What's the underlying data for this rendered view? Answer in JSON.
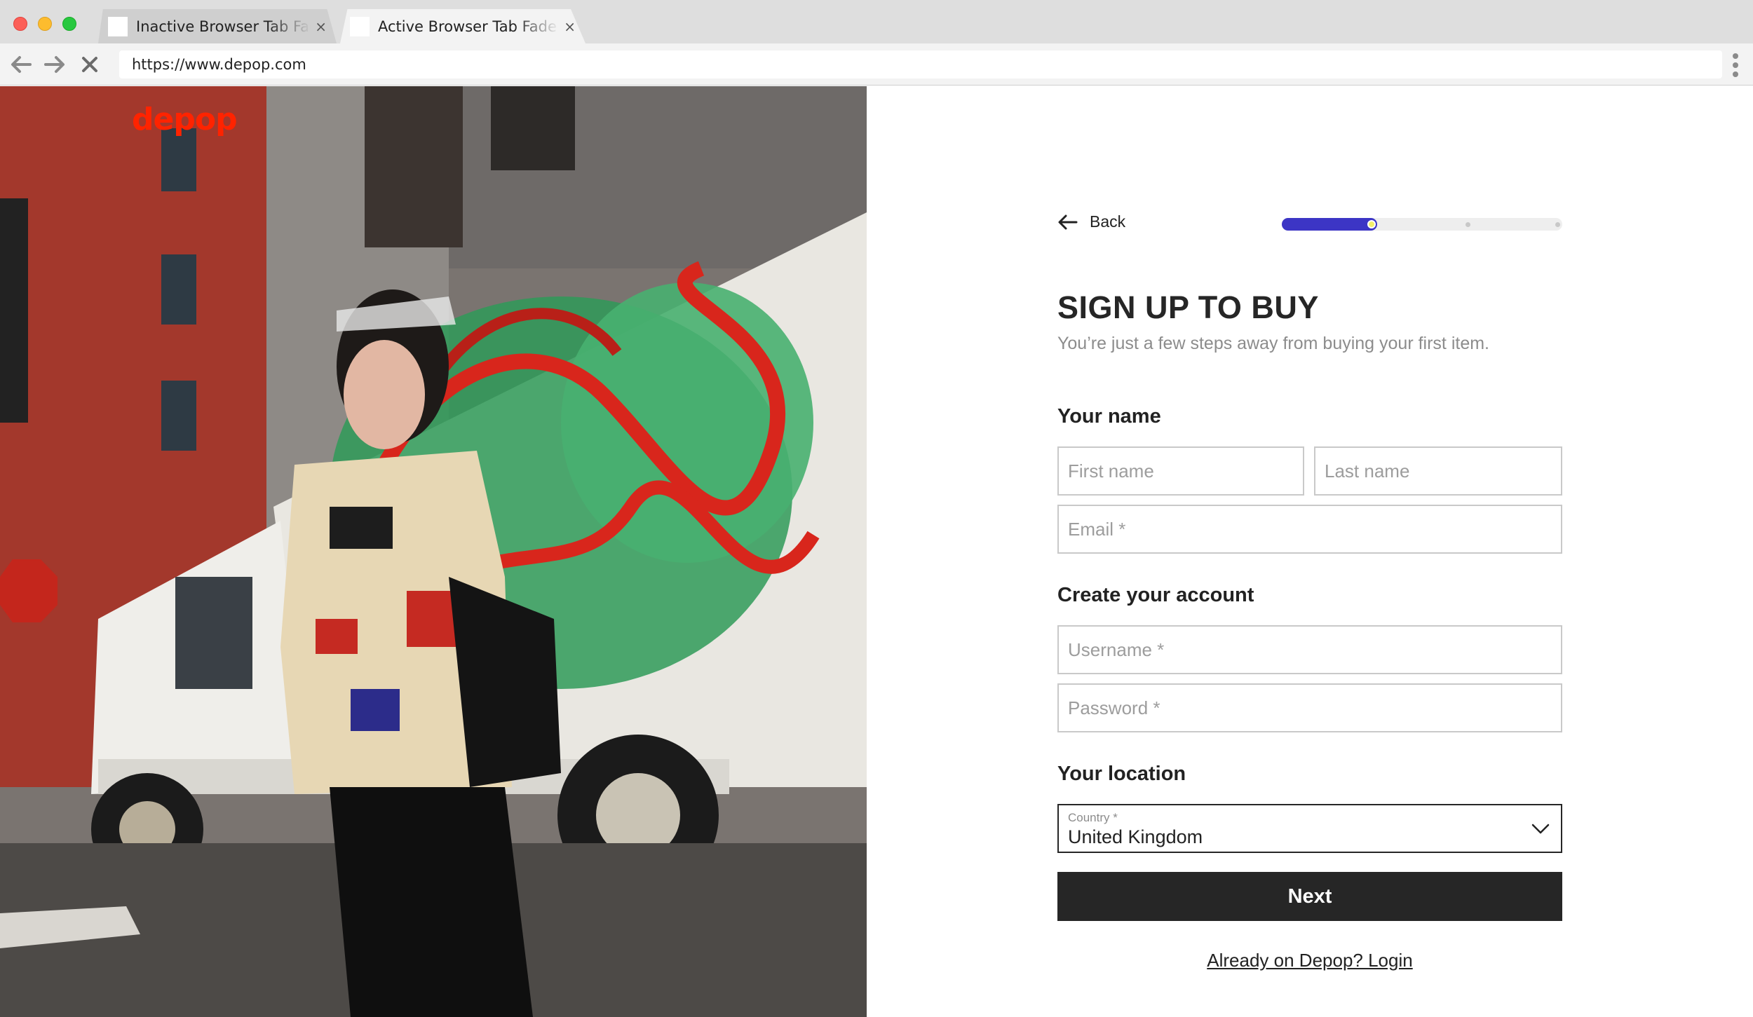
{
  "browser": {
    "tabs": [
      {
        "title": "Inactive Browser Tab Fad",
        "active": false
      },
      {
        "title": "Active Browser Tab Fade",
        "active": true
      }
    ],
    "url": "https://www.depop.com",
    "close_glyph": "×"
  },
  "hero": {
    "logo": "depop",
    "brand_color": "#ff2300"
  },
  "form": {
    "back_label": "Back",
    "progress": {
      "step": 1,
      "total_steps": 3,
      "fraction": 0.34,
      "fill_color": "#3c35c5"
    },
    "heading": "SIGN UP TO BUY",
    "subtitle": "You’re just a few steps away from buying your first item.",
    "sections": {
      "name": "Your name",
      "account": "Create your account",
      "location": "Your location"
    },
    "fields": {
      "first_name": {
        "placeholder": "First name",
        "value": ""
      },
      "last_name": {
        "placeholder": "Last name",
        "value": ""
      },
      "email": {
        "placeholder": "Email *",
        "value": ""
      },
      "username": {
        "placeholder": "Username *",
        "value": ""
      },
      "password": {
        "placeholder": "Password *",
        "value": ""
      }
    },
    "country": {
      "label": "Country *",
      "value": "United Kingdom"
    },
    "next_label": "Next",
    "login_link": "Already on Depop? Login"
  },
  "icons": {
    "back": "arrow-left-icon",
    "dropdown": "chevron-down-icon",
    "nav_back": "back-arrow-icon",
    "nav_forward": "forward-arrow-icon",
    "nav_stop": "stop-icon",
    "menu": "vertical-dots-icon"
  }
}
